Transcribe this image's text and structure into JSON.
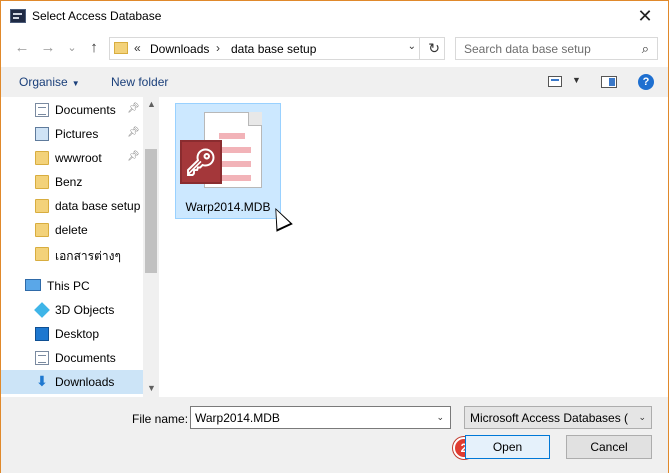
{
  "window": {
    "title": "Select Access Database"
  },
  "nav": {
    "back": "←",
    "forward": "→",
    "recent": "⌄",
    "up": "↑",
    "breadcrumb": [
      "Downloads",
      "data base setup"
    ],
    "overflow": "«",
    "refresh": "↻",
    "dropdown": "⌄"
  },
  "search": {
    "placeholder": "Search data base setup",
    "icon": "search-icon"
  },
  "toolbar": {
    "organise": "Organise",
    "new_folder": "New folder",
    "help": "?"
  },
  "sidebar": {
    "items": [
      {
        "label": "Documents",
        "icon": "document-icon",
        "pinned": true
      },
      {
        "label": "Pictures",
        "icon": "pictures-icon",
        "pinned": true
      },
      {
        "label": "wwwroot",
        "icon": "folder-icon",
        "pinned": true
      },
      {
        "label": "Benz",
        "icon": "folder-icon",
        "pinned": false
      },
      {
        "label": "data base setup",
        "icon": "folder-icon",
        "pinned": false
      },
      {
        "label": "delete",
        "icon": "folder-icon",
        "pinned": false
      },
      {
        "label": "เอกสารต่างๆ",
        "icon": "folder-icon",
        "pinned": false
      },
      {
        "label": "This PC",
        "icon": "pc-icon",
        "pinned": false
      },
      {
        "label": "3D Objects",
        "icon": "cube-icon",
        "pinned": false
      },
      {
        "label": "Desktop",
        "icon": "desktop-icon",
        "pinned": false
      },
      {
        "label": "Documents",
        "icon": "document-icon",
        "pinned": false
      },
      {
        "label": "Downloads",
        "icon": "download-icon",
        "pinned": false,
        "selected": true
      }
    ]
  },
  "files": [
    {
      "name": "Warp2014.MDB",
      "icon": "access-database-icon",
      "selected": true
    }
  ],
  "footer": {
    "file_name_label": "File name:",
    "file_name_value": "Warp2014.MDB",
    "file_type": "Microsoft Access Databases (*.mdb)",
    "open": "Open",
    "cancel": "Cancel",
    "step_number": "2"
  },
  "colors": {
    "accent": "#0078d7",
    "selection": "#cce8ff",
    "step_badge": "#e03c31",
    "window_border": "#e0892b"
  }
}
